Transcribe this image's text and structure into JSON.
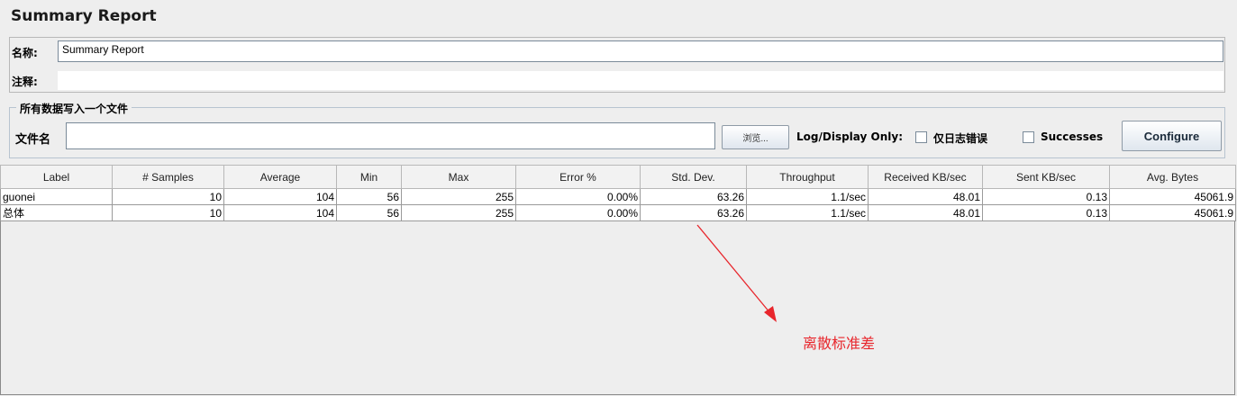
{
  "title": "Summary Report",
  "name_label": "名称:",
  "name_value": "Summary Report",
  "comment_label": "注释:",
  "comment_value": "",
  "file_group_legend": "所有数据写入一个文件",
  "filename_label": "文件名",
  "filename_value": "",
  "browse_label": "浏览...",
  "log_display_label": "Log/Display Only:",
  "errors_only_label": "仅日志错误",
  "successes_label": "Successes",
  "configure_label": "Configure",
  "table": {
    "headers": [
      "Label",
      "# Samples",
      "Average",
      "Min",
      "Max",
      "Error %",
      "Std. Dev.",
      "Throughput",
      "Received KB/sec",
      "Sent KB/sec",
      "Avg. Bytes"
    ],
    "rows": [
      [
        "guonei",
        "10",
        "104",
        "56",
        "255",
        "0.00%",
        "63.26",
        "1.1/sec",
        "48.01",
        "0.13",
        "45061.9"
      ],
      [
        "总体",
        "10",
        "104",
        "56",
        "255",
        "0.00%",
        "63.26",
        "1.1/sec",
        "48.01",
        "0.13",
        "45061.9"
      ]
    ]
  },
  "annotation": "离散标准差",
  "colors": {
    "annotation": "#e8262c"
  }
}
